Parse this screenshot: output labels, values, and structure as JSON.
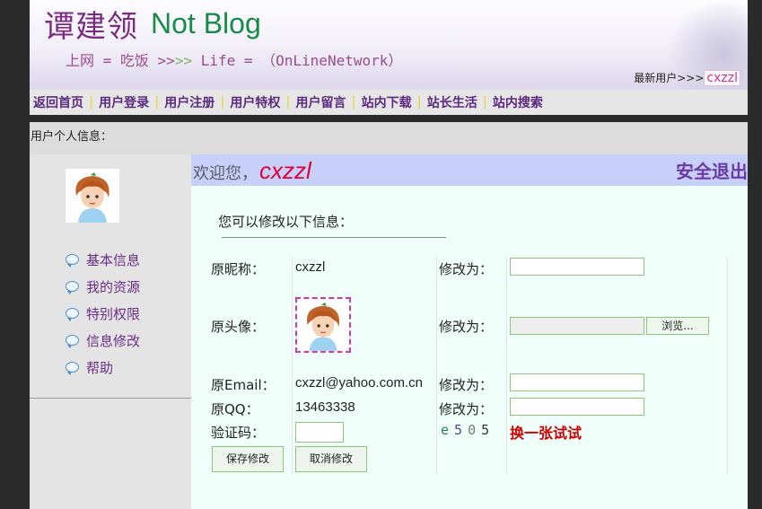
{
  "header": {
    "logo_cn": "谭建领",
    "logo_en": "Not Blog",
    "slogan_a": "上网 = 吃饭 ",
    "slogan_arr1": ">>",
    "slogan_arr2": ">>",
    "slogan_b": " Life = （OnLineNetwork）",
    "newest_label": "最新用户>>>",
    "newest_user": "cxzzl"
  },
  "nav": {
    "items": [
      "返回首页",
      "用户登录",
      "用户注册",
      "用户特权",
      "用户留言",
      "站内下载",
      "站长生活",
      "站内搜索"
    ],
    "separator": "|"
  },
  "infobar": {
    "label": "用户个人信息："
  },
  "sidebar": {
    "menu": [
      "基本信息",
      "我的资源",
      "特别权限",
      "信息修改",
      "帮助"
    ]
  },
  "main": {
    "welcome": "欢迎您，",
    "username": "cxzzl",
    "logout": "安全退出",
    "hint": "您可以修改以下信息：",
    "rows": {
      "nickname_label": "原昵称：",
      "nickname_value": "cxzzl",
      "avatar_label": "原头像：",
      "email_label": "原Email：",
      "email_value": "cxzzl@yahoo.com.cn",
      "qq_label": "原QQ：",
      "qq_value": "13463338",
      "captcha_label": "验证码："
    },
    "change_label": "修改为：",
    "browse_label": "浏览...",
    "captcha": [
      "e",
      "5",
      "0",
      "5"
    ],
    "refresh_label": "换一张试试",
    "save_label": "保存修改",
    "cancel_label": "取消修改"
  }
}
